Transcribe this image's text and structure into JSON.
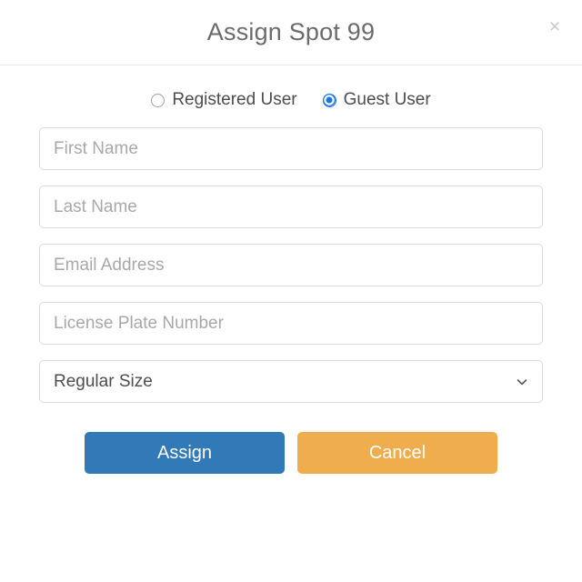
{
  "modal": {
    "title": "Assign Spot 99",
    "close_label": "×",
    "close_icon": "close-icon"
  },
  "user_type": {
    "options": [
      {
        "label": "Registered User",
        "value": "registered",
        "selected": false
      },
      {
        "label": "Guest User",
        "value": "guest",
        "selected": true
      }
    ],
    "selected_value": "guest"
  },
  "fields": [
    {
      "name": "first-name",
      "placeholder": "First Name",
      "value": ""
    },
    {
      "name": "last-name",
      "placeholder": "Last Name",
      "value": ""
    },
    {
      "name": "email-address",
      "placeholder": "Email Address",
      "value": ""
    },
    {
      "name": "license-plate-number",
      "placeholder": "License Plate Number",
      "value": ""
    }
  ],
  "size_select": {
    "selected_label": "Regular Size",
    "options": [
      "Regular Size"
    ],
    "chevron_icon": "chevron-down-icon"
  },
  "buttons": {
    "assign_label": "Assign",
    "cancel_label": "Cancel"
  },
  "colors": {
    "assign_blue": "#3279b7",
    "cancel_orange": "#efad4e",
    "radio_blue": "#1a73e8",
    "title_gray": "#6b6b6b",
    "placeholder_gray": "#a8a8a8",
    "border_gray": "#dcdcdc"
  }
}
